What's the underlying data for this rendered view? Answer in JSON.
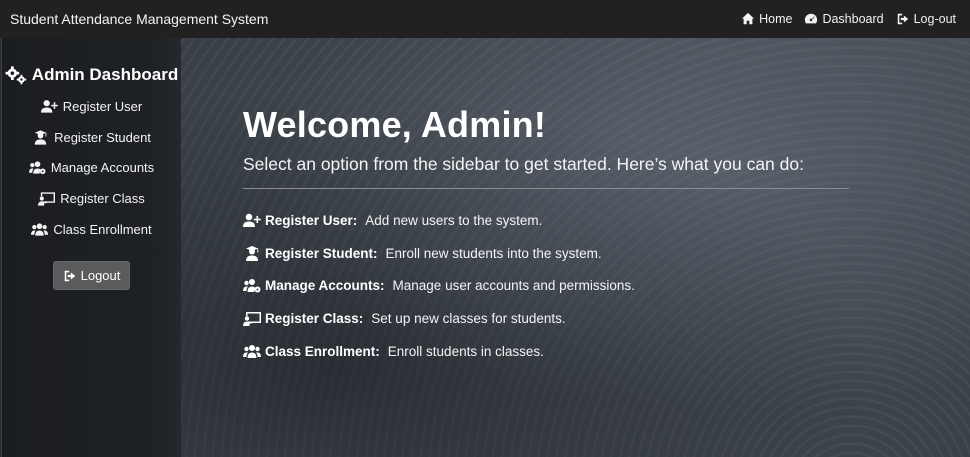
{
  "navbar": {
    "brand": "Student Attendance Management System",
    "links": [
      {
        "label": "Home",
        "icon": "home-icon"
      },
      {
        "label": "Dashboard",
        "icon": "gauge-icon"
      },
      {
        "label": "Log-out",
        "icon": "sign-out-icon"
      }
    ]
  },
  "sidebar": {
    "title": "Admin Dashboard",
    "title_icon": "cogs-icon",
    "items": [
      {
        "label": "Register User",
        "icon": "user-plus-icon"
      },
      {
        "label": "Register Student",
        "icon": "user-graduate-icon"
      },
      {
        "label": "Manage Accounts",
        "icon": "users-cog-icon"
      },
      {
        "label": "Register Class",
        "icon": "chalkboard-icon"
      },
      {
        "label": "Class Enrollment",
        "icon": "users-icon"
      }
    ],
    "logout_label": "Logout"
  },
  "main": {
    "heading": "Welcome, Admin!",
    "subtitle": "Select an option from the sidebar to get started. Here’s what you can do:",
    "features": [
      {
        "title": "Register User:",
        "desc": "Add new users to the system.",
        "icon": "user-plus-icon"
      },
      {
        "title": "Register Student:",
        "desc": "Enroll new students into the system.",
        "icon": "user-graduate-icon"
      },
      {
        "title": "Manage Accounts:",
        "desc": "Manage user accounts and permissions.",
        "icon": "users-cog-icon"
      },
      {
        "title": "Register Class:",
        "desc": "Set up new classes for students.",
        "icon": "chalkboard-icon"
      },
      {
        "title": "Class Enrollment:",
        "desc": "Enroll students in classes.",
        "icon": "users-icon"
      }
    ]
  }
}
